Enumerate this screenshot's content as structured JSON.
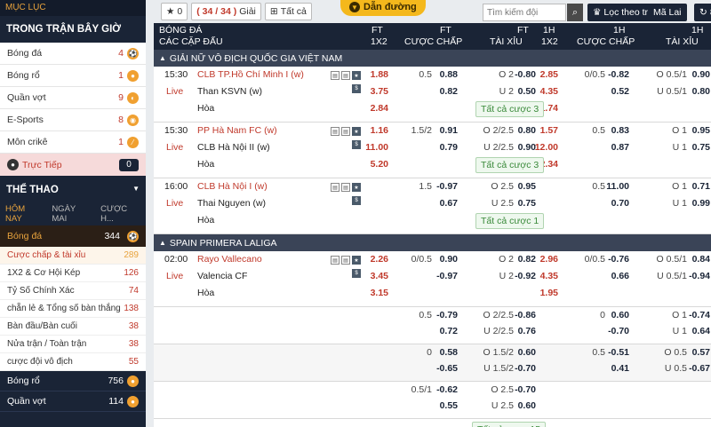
{
  "sidebar": {
    "header": "MỤC LỤC",
    "title": "TRONG TRẬN BÂY GIỜ",
    "items": [
      {
        "label": "Bóng đá",
        "count": "4",
        "icon": "football-icon"
      },
      {
        "label": "Bóng rổ",
        "count": "1",
        "icon": "basketball-icon"
      },
      {
        "label": "Quần vợt",
        "count": "9",
        "icon": "tennis-icon"
      },
      {
        "label": "E-Sports",
        "count": "8",
        "icon": "gamepad-icon"
      },
      {
        "label": "Môn crikê",
        "count": "1",
        "icon": "cricket-icon"
      }
    ],
    "live": {
      "label": "Trực Tiếp",
      "count": "0"
    },
    "sports_title": "THỂ THAO",
    "tabs": [
      "HÔM NAY",
      "NGÀY MAI",
      "CƯỢC H..."
    ],
    "category": {
      "label": "Bóng đá",
      "count": "344"
    },
    "subitems": [
      {
        "label": "Cược chấp & tài xỉu",
        "count": "289"
      },
      {
        "label": "1X2 & Cơ Hội Kép",
        "count": "126"
      },
      {
        "label": "Tỷ Số Chính Xác",
        "count": "74"
      },
      {
        "label": "chẵn lẻ & Tổng số bàn thắng",
        "count": "138"
      },
      {
        "label": "Bàn đầu/Bàn cuối",
        "count": "38"
      },
      {
        "label": "Nửa trận / Toàn trận",
        "count": "38"
      },
      {
        "label": "cược đội vô địch",
        "count": "55"
      }
    ],
    "footer": [
      {
        "label": "Bóng rổ",
        "count": "756"
      },
      {
        "label": "Quần vợt",
        "count": "114"
      }
    ]
  },
  "toolbar": {
    "star_count": "0",
    "games": "( 34 / 34 )",
    "games_label": "Giải",
    "all_label": "Tất cả",
    "guide": "Dẫn đường",
    "search_placeholder": "Tìm kiếm đội",
    "filter": "Lọc theo trận",
    "refresh": "Mã Lai",
    "refresh_count": "85"
  },
  "columns": {
    "sport": "BÓNG ĐÁ",
    "sub": "CÁC CẶP ĐẤU",
    "c1": "FT",
    "c1s": "1X2",
    "c2": "FT",
    "c2s": "CƯỢC CHẤP",
    "c3": "FT",
    "c3s": "TÀI XỈU",
    "c4": "1H",
    "c4s": "1X2",
    "c5": "1H",
    "c5s": "CƯỢC CHẤP",
    "c6": "1H",
    "c6s": "TÀI XỈU"
  },
  "leagues": [
    {
      "name": "GIẢI NỮ VÔ ĐỊCH QUỐC GIA VIỆT NAM",
      "matches": [
        {
          "time": "15:30",
          "status": "Live",
          "home": "CLB TP.Hồ Chí Minh I (w)",
          "away": "Than KSVN (w)",
          "draw": "Hòa",
          "ft1x2": [
            "1.88",
            "3.75",
            "2.84"
          ],
          "fthcp": [
            "0.5",
            "0.88",
            "",
            "0.82"
          ],
          "ftou": [
            "O 2",
            "-0.80",
            "U 2",
            "0.50"
          ],
          "h1x2": [
            "2.85",
            "4.35",
            "1.74"
          ],
          "hhcp": [
            "0/0.5",
            "-0.82",
            "",
            "0.52"
          ],
          "hou": [
            "O 0.5/1",
            "0.90",
            "U 0.5/1",
            "0.80"
          ],
          "all": "Tất cả cược 3"
        },
        {
          "time": "15:30",
          "status": "Live",
          "home": "PP Hà Nam FC (w)",
          "away": "CLB Hà Nội II (w)",
          "draw": "Hòa",
          "ft1x2": [
            "1.16",
            "11.00",
            "5.20"
          ],
          "fthcp": [
            "1.5/2",
            "0.91",
            "",
            "0.79"
          ],
          "ftou": [
            "O 2/2.5",
            "0.80",
            "U 2/2.5",
            "0.90"
          ],
          "h1x2": [
            "1.57",
            "12.00",
            "2.34"
          ],
          "hhcp": [
            "0.5",
            "0.83",
            "",
            "0.87"
          ],
          "hou": [
            "O 1",
            "0.95",
            "U 1",
            "0.75"
          ],
          "all": "Tất cả cược 3"
        },
        {
          "time": "16:00",
          "status": "Live",
          "home": "CLB Hà Nội I (w)",
          "away": "Thai Nguyen (w)",
          "draw": "Hòa",
          "ft1x2": [
            "",
            "",
            ""
          ],
          "fthcp": [
            "1.5",
            "-0.97",
            "",
            "0.67"
          ],
          "ftou": [
            "O 2.5",
            "0.95",
            "U 2.5",
            "0.75"
          ],
          "h1x2": [
            "",
            "",
            ""
          ],
          "hhcp": [
            "0.5",
            "11.00",
            "",
            "0.70"
          ],
          "hou": [
            "O 1",
            "0.71",
            "U 1",
            "0.99"
          ],
          "all": "Tất cả cược 1"
        }
      ]
    },
    {
      "name": "SPAIN PRIMERA LALIGA",
      "matches": [
        {
          "time": "02:00",
          "status": "Live",
          "home": "Rayo Vallecano",
          "away": "Valencia CF",
          "draw": "Hòa",
          "ft1x2": [
            "2.26",
            "3.45",
            "3.15"
          ],
          "fthcp": [
            "0/0.5",
            "0.90",
            "",
            "-0.97"
          ],
          "ftou": [
            "O 2",
            "0.82",
            "U 2",
            "-0.92"
          ],
          "h1x2": [
            "2.96",
            "4.35",
            "1.95"
          ],
          "hhcp": [
            "0/0.5",
            "-0.76",
            "",
            "0.66"
          ],
          "hou": [
            "O 0.5/1",
            "0.84",
            "U 0.5/1",
            "-0.94"
          ]
        }
      ],
      "extra": [
        {
          "fthcp": [
            "0.5",
            "-0.79",
            "",
            "0.72"
          ],
          "ftou": [
            "O 2/2.5",
            "-0.86",
            "U 2/2.5",
            "0.76"
          ],
          "hhcp": [
            "0",
            "0.60",
            "",
            "-0.70"
          ],
          "hou": [
            "O 1",
            "-0.74",
            "U 1",
            "0.64"
          ]
        },
        {
          "fthcp": [
            "0",
            "0.58",
            "",
            "-0.65"
          ],
          "ftou": [
            "O 1.5/2",
            "0.60",
            "U 1.5/2",
            "-0.70"
          ],
          "hhcp": [
            "0.5",
            "-0.51",
            "",
            "0.41"
          ],
          "hou": [
            "O 0.5",
            "0.57",
            "U 0.5",
            "-0.67"
          ]
        },
        {
          "fthcp": [
            "0.5/1",
            "-0.62",
            "",
            "0.55"
          ],
          "ftou": [
            "O 2.5",
            "-0.70",
            "U 2.5",
            "0.60"
          ],
          "hhcp": [
            "",
            "",
            "",
            ""
          ],
          "hou": [
            "",
            "",
            "",
            ""
          ]
        }
      ],
      "all": "Tất cả cược 15"
    }
  ]
}
